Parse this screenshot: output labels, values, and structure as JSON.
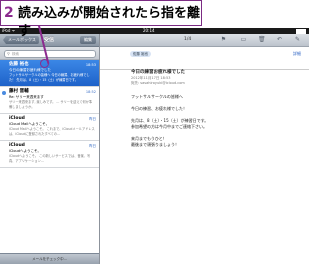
{
  "callout": {
    "number": "2",
    "text": "読み込みが開始されたら指を離す"
  },
  "status": {
    "carrier": "iPod ᯤ",
    "time": "20:14"
  },
  "left": {
    "back_label": "メールボックス",
    "title": "受信",
    "edit_label": "編集",
    "search_placeholder": "検索",
    "items": [
      {
        "from": "佐藤 裕也",
        "date": "18:53",
        "subject": "今日の練習お疲れ様でした",
        "preview": "フットサルサークルの皆様へ 今日の練習、お疲れ様でした！ 先月は、8（土）・15（土）が練習日です。"
      },
      {
        "from": "藤村 晋輔",
        "date": "18:52",
        "subject": "Re: サリー来週来ます",
        "preview": "サリー来週来ます, 楽しみです。 ... サリーを迎えて何か準備しましょうか。"
      },
      {
        "from": "iCloud",
        "date": "昨日",
        "subject": "iCloud Mailへようこそ。",
        "preview": "iCloud Mailへようこそ。 これまで、iCloudメールアドレスは、iCloudに登録されたすべての..."
      },
      {
        "from": "iCloud",
        "date": "昨日",
        "subject": "iCloudへようこそ。",
        "preview": "iCloudへようこそ。 この新しいサービスでは、音楽、写真、アプリケーション..."
      }
    ],
    "update_text": "メールをチェック中..."
  },
  "right": {
    "counter": "1/4",
    "from_chip": "佐藤 裕也",
    "detail_label": "詳細",
    "mail_subject": "今日の練習お疲れ様でした",
    "mail_date": "2012年11月17日 18:53",
    "mail_to": "宛先: sasahiroyuki@icloud.com",
    "body_lines": [
      "フットサルサークルの皆様へ",
      "",
      "今日の練習、お疲れ様でした！",
      "",
      "先月は、8（土）・15（土）が練習日です。",
      "参加希望の方は今月中までご連絡下さい。",
      "",
      "来月までもうひと！",
      "最後まで頑張りましょう！"
    ]
  },
  "colors": {
    "accent": "#8b2a8e",
    "selection": "#1e62c9"
  }
}
